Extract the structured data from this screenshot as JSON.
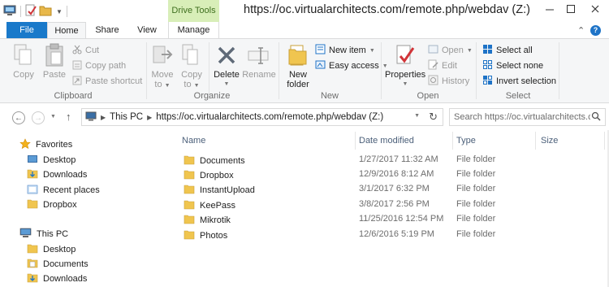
{
  "window": {
    "title": "https://oc.virtualarchitects.com/remote.php/webdav (Z:)",
    "context_tab_group": "Drive Tools",
    "controls": [
      "minimize",
      "maximize",
      "close"
    ]
  },
  "tabs": {
    "file": "File",
    "home": "Home",
    "share": "Share",
    "view": "View",
    "manage": "Manage",
    "help": "?"
  },
  "ribbon": {
    "clipboard": {
      "label": "Clipboard",
      "copy": "Copy",
      "paste": "Paste",
      "cut": "Cut",
      "copy_path": "Copy path",
      "paste_shortcut": "Paste shortcut"
    },
    "organize": {
      "label": "Organize",
      "move_to": [
        "Move",
        "to"
      ],
      "copy_to": [
        "Copy",
        "to"
      ],
      "delete": "Delete",
      "rename": "Rename"
    },
    "new": {
      "label": "New",
      "new_folder": [
        "New",
        "folder"
      ],
      "new_item": "New item",
      "easy_access": "Easy access"
    },
    "open": {
      "label": "Open",
      "properties": "Properties",
      "open": "Open",
      "edit": "Edit",
      "history": "History"
    },
    "select": {
      "label": "Select",
      "select_all": "Select all",
      "select_none": "Select none",
      "invert_selection": "Invert selection"
    }
  },
  "address": {
    "crumbs": [
      "This PC",
      "https://oc.virtualarchitects.com/remote.php/webdav (Z:)"
    ],
    "search_placeholder": "Search https://oc.virtualarchitects.com/remote.php/webdav (Z:)"
  },
  "navpane": {
    "favorites": {
      "label": "Favorites",
      "items": [
        "Desktop",
        "Downloads",
        "Recent places",
        "Dropbox"
      ]
    },
    "this_pc": {
      "label": "This PC",
      "items": [
        "Desktop",
        "Documents",
        "Downloads"
      ]
    }
  },
  "filelist": {
    "columns": {
      "name": "Name",
      "date": "Date modified",
      "type": "Type",
      "size": "Size"
    },
    "rows": [
      {
        "name": "Documents",
        "date": "1/27/2017 11:32 AM",
        "type": "File folder"
      },
      {
        "name": "Dropbox",
        "date": "12/9/2016 8:12 AM",
        "type": "File folder"
      },
      {
        "name": "InstantUpload",
        "date": "3/1/2017 6:32 PM",
        "type": "File folder"
      },
      {
        "name": "KeePass",
        "date": "3/8/2017 2:56 PM",
        "type": "File folder"
      },
      {
        "name": "Mikrotik",
        "date": "11/25/2016 12:54 PM",
        "type": "File folder"
      },
      {
        "name": "Photos",
        "date": "12/6/2016 5:19 PM",
        "type": "File folder"
      }
    ]
  },
  "colors": {
    "file_tab": "#1979ca",
    "context_tab": "#d8eeb8",
    "ribbon_bg": "#f5f6f7",
    "folder": "#e8b84a",
    "column_header_text": "#4c607a"
  }
}
